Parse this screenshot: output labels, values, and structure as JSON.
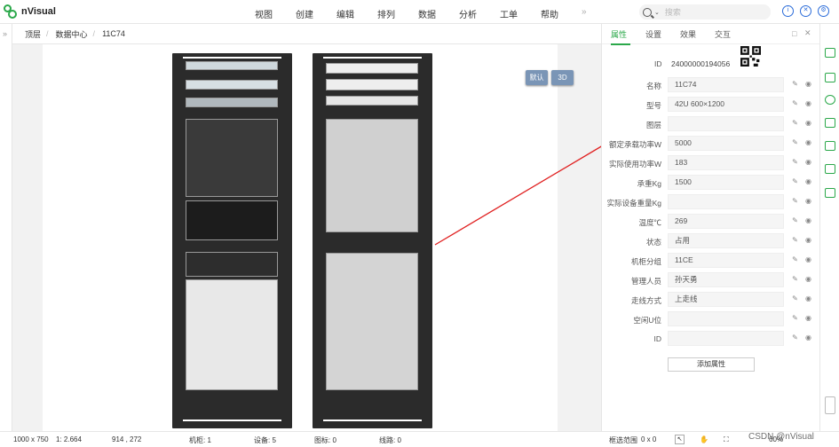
{
  "app": {
    "name": "nVisual"
  },
  "menu": {
    "items": [
      "视图",
      "创建",
      "编辑",
      "排列",
      "数据",
      "分析",
      "工单",
      "帮助"
    ],
    "more": "»"
  },
  "search": {
    "placeholder": "搜索"
  },
  "breadcrumb": {
    "items": [
      "顶层",
      "数据中心",
      "11C74"
    ]
  },
  "canvas": {
    "view_default": "默认",
    "view_3d": "3D"
  },
  "panel": {
    "tabs": [
      "属性",
      "设置",
      "效果",
      "交互"
    ],
    "active_tab": "属性",
    "id_label": "ID",
    "id_value": "24000000194056",
    "rows": [
      {
        "label": "名称",
        "value": "11C74"
      },
      {
        "label": "型号",
        "value": "42U 600×1200"
      },
      {
        "label": "图层",
        "value": ""
      },
      {
        "label": "额定承载功率W",
        "value": "5000"
      },
      {
        "label": "实际使用功率W",
        "value": "183"
      },
      {
        "label": "承重Kg",
        "value": "1500"
      },
      {
        "label": "实际设备重量Kg",
        "value": ""
      },
      {
        "label": "温度℃",
        "value": "269"
      },
      {
        "label": "状态",
        "value": "占用"
      },
      {
        "label": "机柜分组",
        "value": "11CE"
      },
      {
        "label": "管理人员",
        "value": "孙天勇"
      },
      {
        "label": "走线方式",
        "value": "上走线"
      },
      {
        "label": "空闲U位",
        "value": ""
      },
      {
        "label": "ID",
        "value": ""
      }
    ],
    "add_button": "添加属性"
  },
  "status_bar": {
    "size": "1000 x 750",
    "scale": "1: 2.664",
    "coords": "914 , 272",
    "racks": "机柜: 1",
    "devices": "设备: 5",
    "icons": "图标: 0",
    "lines": "线路: 0",
    "select_range": "框选范围",
    "select_value": "0 x 0",
    "zoom": "60%",
    "watermark": "CSDN @nVisual"
  },
  "colors": {
    "accent": "#2ba84a",
    "blue": "#2b6cd9",
    "arrow": "#e02020"
  }
}
